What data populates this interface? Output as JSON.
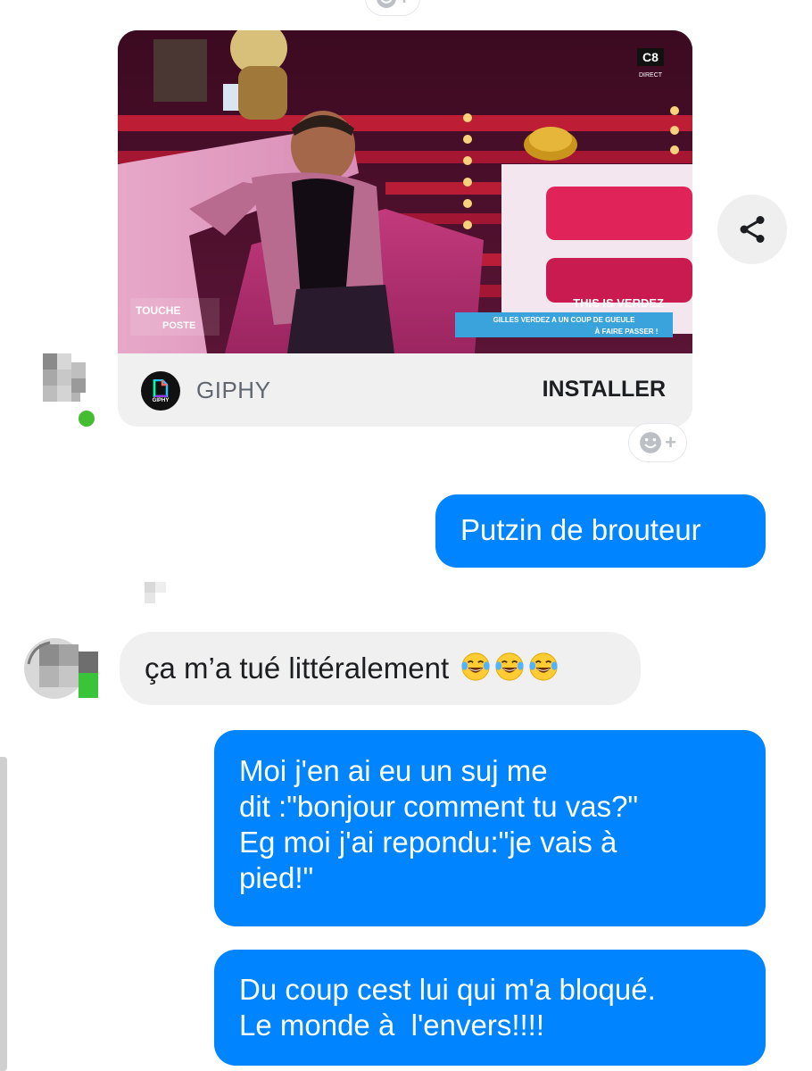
{
  "gif_card": {
    "provider_name": "GIPHY",
    "provider_logo_text": "GIPHY",
    "install_label": "INSTALLER",
    "overlay": {
      "channel": "C8",
      "channel_sub": "DIRECT",
      "show_logo_line1": "TOUCHE",
      "show_logo_line2": "POSTE",
      "banner_title": "THIS IS VERDEZ",
      "banner_line1": "GILLES VERDEZ A UN COUP DE GUEULE",
      "banner_line2": "À FAIRE PASSER !"
    }
  },
  "icons": {
    "share": "share-icon",
    "reaction": "smiley-plus-icon",
    "emoji": "face-with-tears-of-joy-emoji"
  },
  "messages": [
    {
      "direction": "outgoing",
      "text": "Putzin de brouteur"
    },
    {
      "direction": "incoming",
      "text": "ça m’a tué littéralement",
      "emoji_count": 3
    },
    {
      "direction": "outgoing",
      "lines": [
        "Moi j'en ai eu un suj me",
        "dit :\"bonjour comment tu vas?\"",
        "Eg moi j'ai repondu:\"je vais à",
        "pied!\""
      ]
    },
    {
      "direction": "outgoing",
      "lines": [
        "Du coup cest lui qui m'a bloqué.",
        "Le monde à  l'envers!!!!"
      ]
    }
  ],
  "colors": {
    "outgoing_bubble": "#0084ff",
    "incoming_bubble": "#f1f0f0",
    "online_dot": "#44bd32"
  }
}
